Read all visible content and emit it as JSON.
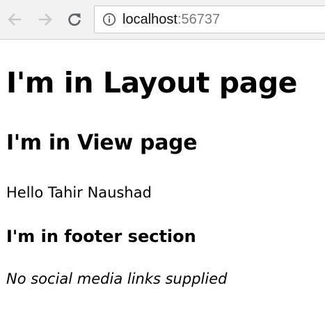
{
  "browser": {
    "url_host": "localhost",
    "url_port": ":56737",
    "icons": {
      "back": "back-arrow-icon",
      "forward": "forward-arrow-icon",
      "reload": "reload-icon",
      "info": "info-icon"
    }
  },
  "page": {
    "layout_heading": "I'm in Layout page",
    "view_heading": "I'm in View page",
    "greeting": "Hello Tahir Naushad",
    "footer_heading": "I'm in footer section",
    "social_links_message": "No social media links supplied"
  }
}
